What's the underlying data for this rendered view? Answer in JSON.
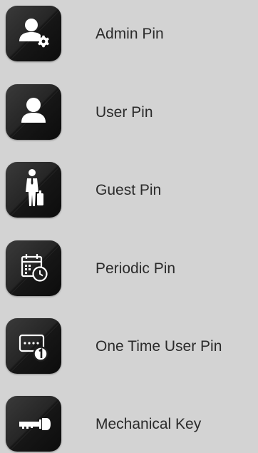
{
  "pin_menu": {
    "items": [
      {
        "label": "Admin Pin",
        "icon": "admin-user-gear-icon"
      },
      {
        "label": "User Pin",
        "icon": "user-icon"
      },
      {
        "label": "Guest Pin",
        "icon": "guest-luggage-icon"
      },
      {
        "label": "Periodic Pin",
        "icon": "calendar-clock-icon"
      },
      {
        "label": "One Time User Pin",
        "icon": "one-time-pin-icon"
      },
      {
        "label": "Mechanical Key",
        "icon": "key-icon"
      }
    ]
  },
  "colors": {
    "background": "#d3d3d3",
    "tile_dark": "#1a1a1a",
    "icon": "#ffffff",
    "label_text": "#2b2b2b"
  }
}
